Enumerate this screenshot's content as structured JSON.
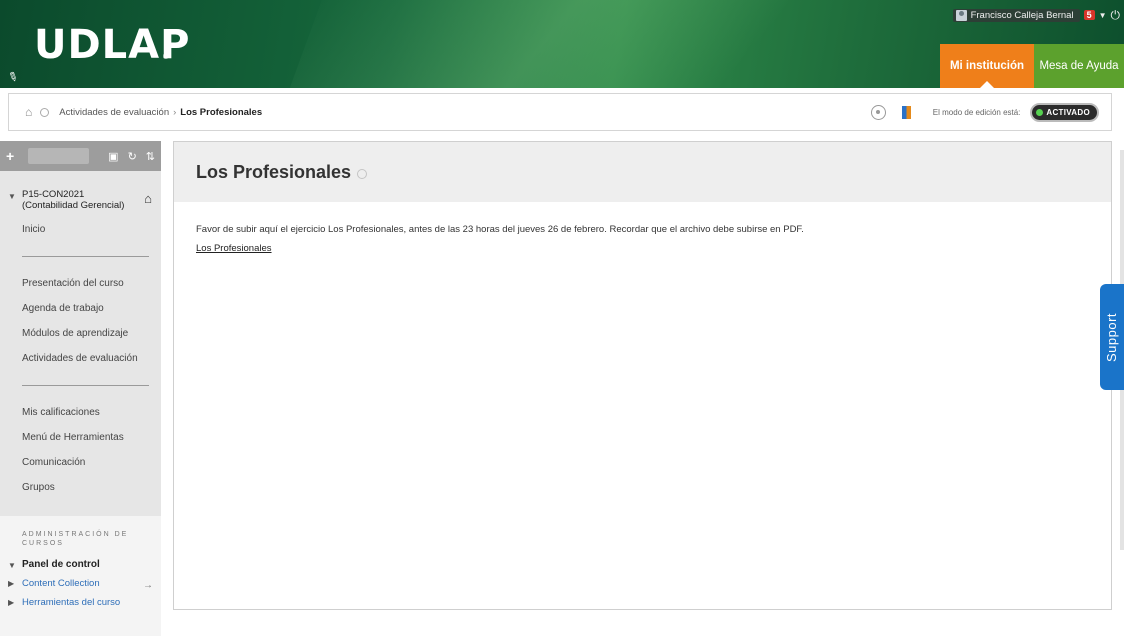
{
  "header": {
    "logo": "UDLAP",
    "logo_mark": "®",
    "user_name": "Francisco Calleja Bernal",
    "notification_count": "5",
    "nav": {
      "institution": "Mi institución",
      "help_desk": "Mesa de Ayuda"
    },
    "colors": {
      "header_green": "#16683c",
      "institution_tab": "#ef7f1a",
      "help_tab": "#5ca12d"
    }
  },
  "breadcrumb": {
    "parent": "Actividades de evaluación",
    "separator": "›",
    "current": "Los Profesionales",
    "edit_mode_label": "El modo de edición está:",
    "edit_mode_state": "ACTIVADO"
  },
  "sidebar": {
    "course_name": "P15-CON2021 (Contabilidad Gerencial)",
    "home_link": "Inicio",
    "group1": [
      "Presentación del curso",
      "Agenda de trabajo",
      "Módulos de aprendizaje",
      "Actividades de evaluación"
    ],
    "group2": [
      "Mis calificaciones",
      "Menú de Herramientas",
      "Comunicación",
      "Grupos"
    ],
    "admin_heading": "ADMINISTRACIÓN DE CURSOS",
    "control_panel": "Panel de control",
    "content_collection": "Content Collection",
    "course_tools": "Herramientas del curso"
  },
  "main": {
    "title": "Los Profesionales",
    "description": "Favor de subir aquí el ejercicio Los Profesionales, antes de las 23 horas del jueves 26 de febrero. Recordar que el archivo debe subirse en PDF.",
    "link": "Los Profesionales"
  },
  "support_tab": "Support"
}
